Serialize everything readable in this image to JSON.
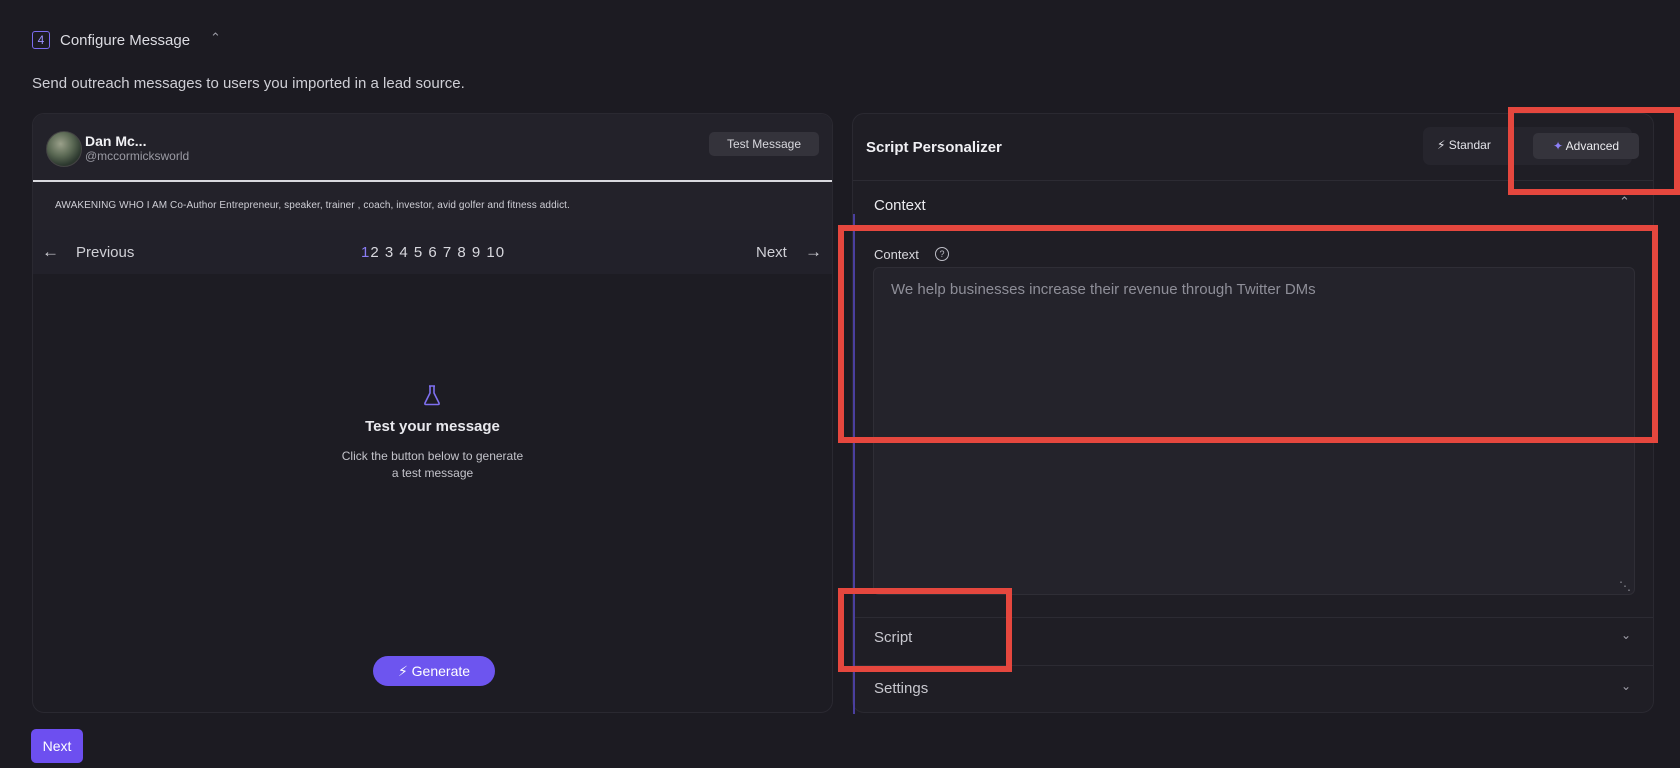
{
  "section": {
    "step_number": "4",
    "title": "Configure Message",
    "description": "Send outreach messages to users you imported in a lead source."
  },
  "profile": {
    "name": "Dan Mc...",
    "handle": "@mccormicksworld",
    "test_message_label": "Test Message",
    "bio": "AWAKENING WHO I AM Co-Author Entrepreneur, speaker, trainer , coach, investor, avid golfer and fitness addict."
  },
  "pager": {
    "previous_label": "Previous",
    "next_label": "Next",
    "active_page": "1",
    "other_pages": "2 3 4 5 6 7 8 9 10"
  },
  "empty_state": {
    "title": "Test your message",
    "line1": "Click the button below to generate",
    "line2": "a test message",
    "generate_label": "Generate"
  },
  "footer": {
    "next_label": "Next"
  },
  "personalizer": {
    "title": "Script Personalizer",
    "mode_standard": "Standar",
    "mode_advanced": "Advanced",
    "context_section": "Context",
    "context_field_label": "Context",
    "context_value": "We help businesses increase their revenue through Twitter DMs",
    "script_section": "Script",
    "settings_section": "Settings"
  },
  "colors": {
    "accent": "#6d55ef",
    "highlight": "#e5473e",
    "background": "#1c1b22"
  }
}
